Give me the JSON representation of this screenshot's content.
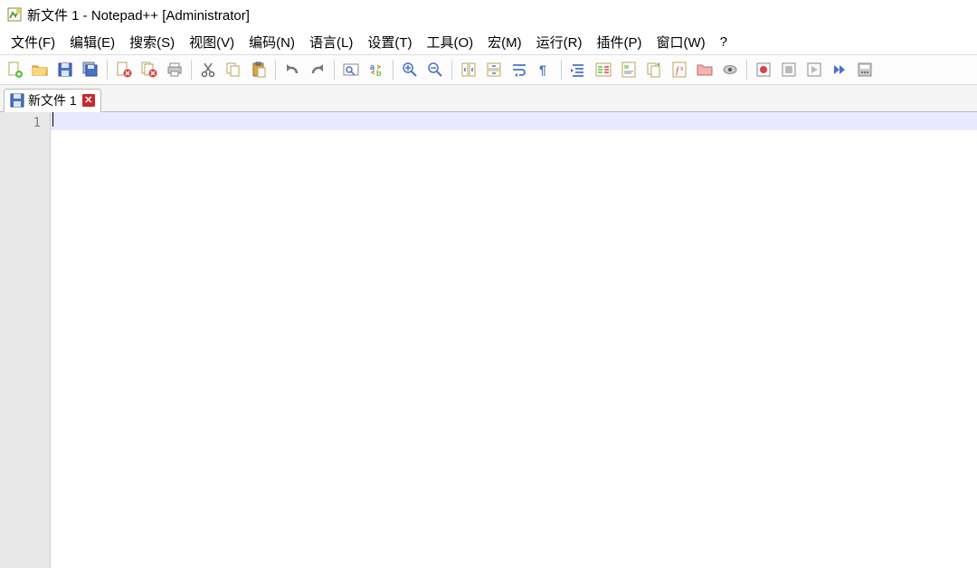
{
  "title": "新文件 1 - Notepad++ [Administrator]",
  "menu": {
    "file": "文件(F)",
    "edit": "编辑(E)",
    "search": "搜索(S)",
    "view": "视图(V)",
    "encoding": "编码(N)",
    "language": "语言(L)",
    "settings": "设置(T)",
    "tools": "工具(O)",
    "macro": "宏(M)",
    "run": "运行(R)",
    "plugins": "插件(P)",
    "window": "窗口(W)",
    "help": "?"
  },
  "toolbar": {
    "new": "new-file",
    "open": "open-file",
    "save": "save",
    "saveall": "save-all",
    "close": "close",
    "closeall": "close-all",
    "print": "print",
    "cut": "cut",
    "copy": "copy",
    "paste": "paste",
    "undo": "undo",
    "redo": "redo",
    "find": "find",
    "replace": "replace",
    "zoomin": "zoom-in",
    "zoomout": "zoom-out",
    "sync_v": "sync-vertical",
    "sync_h": "sync-sync-horizontal",
    "wordwrap": "word-wrap",
    "allchars": "show-all-chars",
    "indent": "indent-guide",
    "lang": "user-lang",
    "docmap": "doc-map",
    "docswitch": "doc-switcher",
    "funclist": "function-list",
    "folder": "folder-workspace",
    "monitoring": "monitoring",
    "record": "macro-record",
    "stop": "macro-stop",
    "play": "macro-play",
    "playmulti": "macro-play-multi",
    "savemacro": "macro-save"
  },
  "tab": {
    "label": "新文件 1"
  },
  "gutter": {
    "line1": "1"
  }
}
